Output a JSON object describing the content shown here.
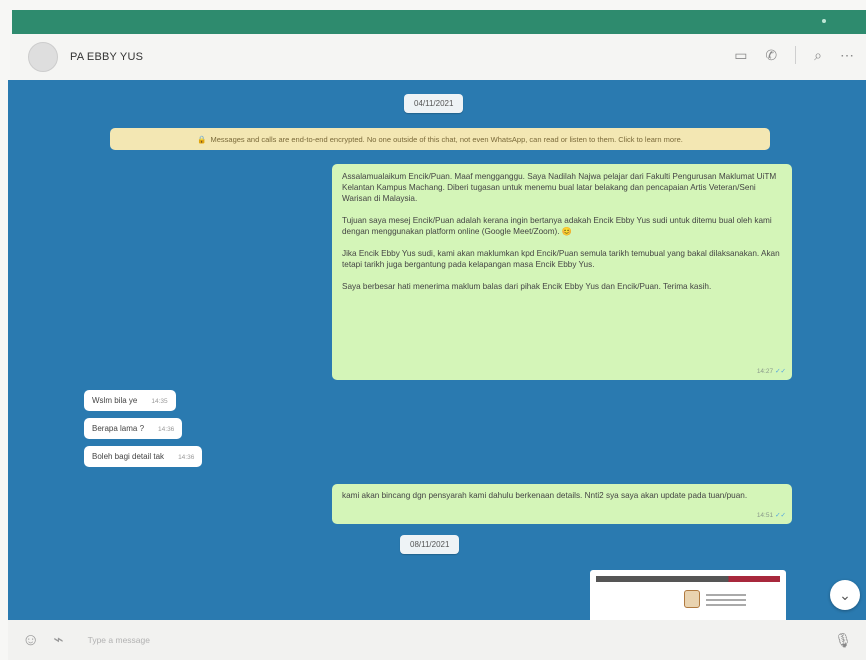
{
  "header": {
    "contact_name": "PA EBBY YUS"
  },
  "dates": {
    "first": "04/11/2021",
    "second": "08/11/2021"
  },
  "notice": {
    "text": "Messages and calls are end-to-end encrypted. No one outside of this chat, not even WhatsApp, can read or listen to them. Click to learn more."
  },
  "messages": {
    "outgoing_1": {
      "paragraphs": [
        "Assalamualaikum Encik/Puan. Maaf mengganggu. Saya Nadilah Najwa pelajar dari Fakulti Pengurusan Maklumat UiTM Kelantan Kampus Machang. Diberi tugasan untuk menemu bual latar belakang dan pencapaian Artis Veteran/Seni Warisan di Malaysia.",
        "Tujuan saya mesej Encik/Puan adalah kerana ingin bertanya adakah Encik Ebby Yus sudi untuk ditemu bual oleh kami dengan menggunakan platform online (Google Meet/Zoom). 😊",
        "Jika Encik Ebby Yus sudi, kami akan maklumkan kpd Encik/Puan semula tarikh temubual yang bakal dilaksanakan. Akan tetapi tarikh juga bergantung pada kelapangan masa Encik Ebby Yus.",
        "Saya berbesar hati menerima maklum balas dari pihak Encik Ebby Yus dan Encik/Puan. Terima kasih."
      ],
      "time": "14:27"
    },
    "incoming": [
      {
        "text": "Wslm bila ye",
        "time": "14:35"
      },
      {
        "text": "Berapa lama ?",
        "time": "14:36"
      },
      {
        "text": "Boleh bagi detail tak",
        "time": "14:36"
      }
    ],
    "outgoing_2": {
      "text": "kami akan bincang dgn pensyarah kami dahulu berkenaan details. Nnti2 sya saya akan update pada tuan/puan.",
      "time": "14:51"
    }
  },
  "composer": {
    "placeholder": "Type a message"
  },
  "icons": [
    "video-call-icon",
    "voice-call-icon",
    "search-icon",
    "menu-icon",
    "emoji-icon",
    "attach-icon",
    "mic-icon",
    "scroll-down-icon"
  ],
  "colors": {
    "topbar": "#2e8b6e",
    "chat_background": "#2a7ab0",
    "outgoing_bubble": "#d4f5b8",
    "notice": "#f3e7b3"
  }
}
